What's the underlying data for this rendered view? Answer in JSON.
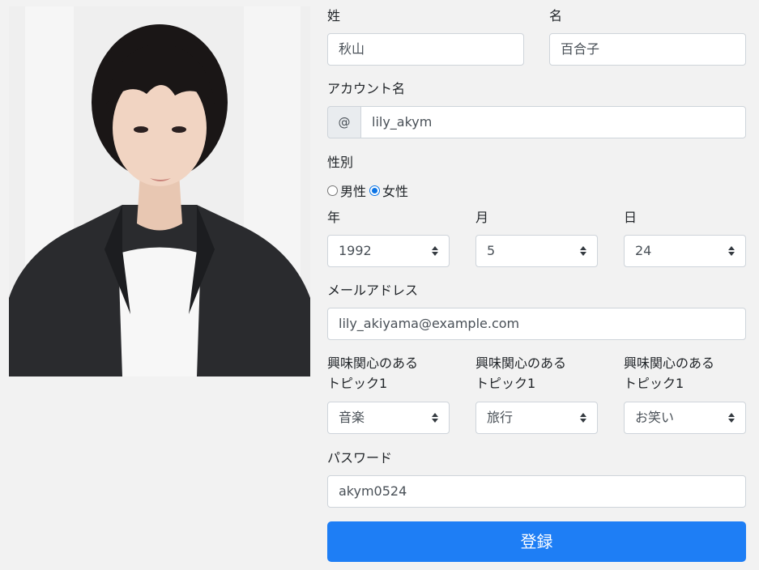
{
  "form": {
    "last_name_label": "姓",
    "last_name_value": "秋山",
    "first_name_label": "名",
    "first_name_value": "百合子",
    "account_label": "アカウント名",
    "account_prefix": "@",
    "account_value": "lily_akym",
    "gender_label": "性別",
    "gender_options": [
      {
        "label": "男性",
        "checked": false
      },
      {
        "label": "女性",
        "checked": true
      }
    ],
    "year_label": "年",
    "year_value": "1992",
    "month_label": "月",
    "month_value": "5",
    "day_label": "日",
    "day_value": "24",
    "email_label": "メールアドレス",
    "email_value": "lily_akiyama@example.com",
    "topics": [
      {
        "label_line1": "興味関心のある",
        "label_line2": "トピック1",
        "value": "音楽"
      },
      {
        "label_line1": "興味関心のある",
        "label_line2": "トピック1",
        "value": "旅行"
      },
      {
        "label_line1": "興味関心のある",
        "label_line2": "トピック1",
        "value": "お笑い"
      }
    ],
    "password_label": "パスワード",
    "password_value": "akym0524",
    "submit_label": "登録"
  },
  "colors": {
    "background": "#f2f2f2",
    "primary_button": "#1e7ef5",
    "radio_checked": "#0b74e5",
    "input_border": "#ced4da",
    "addon_background": "#e9ecef"
  },
  "icons": [
    "profile-photo",
    "select-caret-icon"
  ]
}
